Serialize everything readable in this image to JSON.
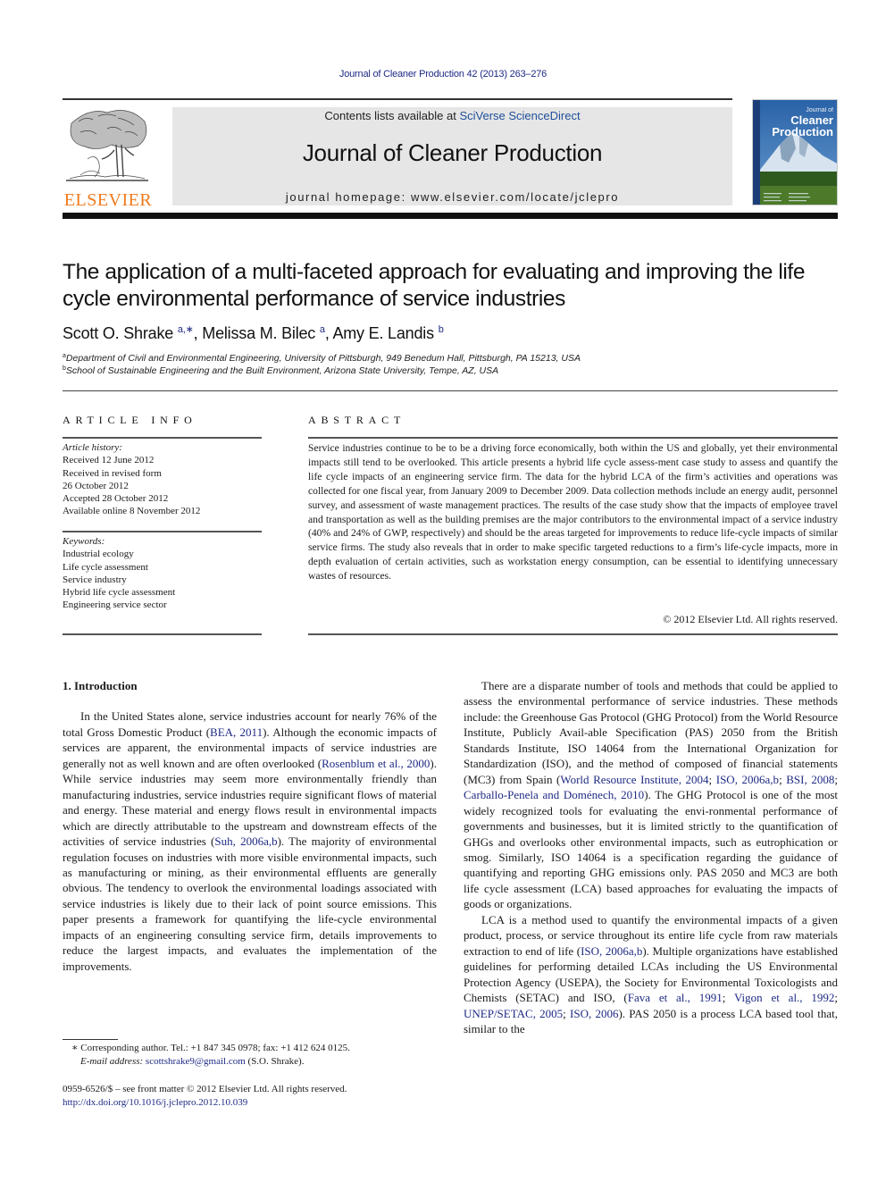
{
  "journal_reference": "Journal of Cleaner Production 42 (2013) 263–276",
  "publisher": {
    "logo_icon": "elsevier-tree-icon",
    "name": "ELSEVIER",
    "brand_color": "#f07a1c"
  },
  "masthead": {
    "contents_prefix": "Contents lists available at ",
    "contents_link": "SciVerse ScienceDirect",
    "journal_title": "Journal of Cleaner Production",
    "homepage": "journal homepage: www.elsevier.com/locate/jclepro"
  },
  "cover": {
    "icon": "journal-cover-mountain-image",
    "small_label": "Journal of",
    "title_line1": "Cleaner",
    "title_line2": "Production"
  },
  "article": {
    "title": "The application of a multi-faceted approach for evaluating and improving the life cycle environmental performance of service industries",
    "authors": [
      {
        "name": "Scott O. Shrake",
        "sup": "a,∗"
      },
      {
        "name": "Melissa M. Bilec",
        "sup": "a"
      },
      {
        "name": "Amy E. Landis",
        "sup": "b"
      }
    ],
    "affiliations": [
      {
        "sup": "a",
        "text": "Department of Civil and Environmental Engineering, University of Pittsburgh, 949 Benedum Hall, Pittsburgh, PA 15213, USA"
      },
      {
        "sup": "b",
        "text": "School of Sustainable Engineering and the Built Environment, Arizona State University, Tempe, AZ, USA"
      }
    ]
  },
  "article_info": {
    "heading": "ARTICLE INFO",
    "history_label": "Article history:",
    "history": [
      "Received 12 June 2012",
      "Received in revised form",
      "26 October 2012",
      "Accepted 28 October 2012",
      "Available online 8 November 2012"
    ],
    "keywords_label": "Keywords:",
    "keywords": [
      "Industrial ecology",
      "Life cycle assessment",
      "Service industry",
      "Hybrid life cycle assessment",
      "Engineering service sector"
    ]
  },
  "abstract": {
    "heading": "ABSTRACT",
    "text": "Service industries continue to be to be a driving force economically, both within the US and globally, yet their environmental impacts still tend to be overlooked. This article presents a hybrid life cycle assess-ment case study to assess and quantify the life cycle impacts of an engineering service firm. The data for the hybrid LCA of the firm’s activities and operations was collected for one fiscal year, from January 2009 to December 2009. Data collection methods include an energy audit, personnel survey, and assessment of waste management practices. The results of the case study show that the impacts of employee travel and transportation as well as the building premises are the major contributors to the environmental impact of a service industry (40% and 24% of GWP, respectively) and should be the areas targeted for improvements to reduce life-cycle impacts of similar service firms. The study also reveals that in order to make specific targeted reductions to a firm’s life-cycle impacts, more in depth evaluation of certain activities, such as workstation energy consumption, can be essential to identifying unnecessary wastes of resources.",
    "copyright": "© 2012 Elsevier Ltd. All rights reserved."
  },
  "body": {
    "section_heading": "1.  Introduction",
    "left_para": [
      {
        "t": "In the United States alone, service industries account for nearly 76% of the total Gross Domestic Product ("
      },
      {
        "l": "BEA, 2011"
      },
      {
        "t": "). Although the economic impacts of services are apparent, the environmental impacts of service industries are generally not as well known and are often overlooked ("
      },
      {
        "l": "Rosenblum et al., 2000"
      },
      {
        "t": "). While service industries may seem more environmentally friendly than manufacturing industries, service industries require significant flows of material and energy. These material and energy flows result in environmental impacts which are directly attributable to the upstream and downstream effects of the activities of service industries ("
      },
      {
        "l": "Suh, 2006a,b"
      },
      {
        "t": "). The majority of environmental regulation focuses on industries with more visible environmental impacts, such as manufacturing or mining, as their environmental effluents are generally obvious. The tendency to overlook the environmental loadings associated with service industries is likely due to their lack of point source emissions. This paper presents a framework for quantifying the life-cycle environmental impacts of an engineering consulting service firm, details improvements to reduce the largest impacts, and evaluates the implementation of the improvements."
      }
    ],
    "right_para_1": [
      {
        "t": "There are a disparate number of tools and methods that could be applied to assess the environmental performance of service industries. These methods include: the Greenhouse Gas Protocol (GHG Protocol) from the World Resource Institute, Publicly Avail-able Specification (PAS) 2050 from the British Standards Institute, ISO 14064 from the International Organization for Standardization (ISO), and the method of composed of financial statements (MC3) from Spain ("
      },
      {
        "l": "World Resource Institute, 2004"
      },
      {
        "t": "; "
      },
      {
        "l": "ISO, 2006a,b"
      },
      {
        "t": "; "
      },
      {
        "l": "BSI, 2008"
      },
      {
        "t": "; "
      },
      {
        "l": "Carballo-Penela and Doménech, 2010"
      },
      {
        "t": "). The GHG Protocol is one of the most widely recognized tools for evaluating the envi-ronmental performance of governments and businesses, but it is limited strictly to the quantification of GHGs and overlooks other environmental impacts, such as eutrophication or smog. Similarly, ISO 14064 is a specification regarding the guidance of quantifying and reporting GHG emissions only. PAS 2050 and MC3 are both life cycle assessment (LCA) based approaches for evaluating the impacts of goods or organizations."
      }
    ],
    "right_para_2": [
      {
        "t": "LCA is a method used to quantify the environmental impacts of a given product, process, or service throughout its entire life cycle from raw materials extraction to end of life ("
      },
      {
        "l": "ISO, 2006a,b"
      },
      {
        "t": "). Multiple organizations have established guidelines for performing detailed LCAs including the US Environmental Protection Agency (USEPA), the Society for Environmental Toxicologists and Chemists (SETAC) and ISO, ("
      },
      {
        "l": "Fava et al., 1991"
      },
      {
        "t": "; "
      },
      {
        "l": "Vigon et al., 1992"
      },
      {
        "t": "; "
      },
      {
        "l": "UNEP/SETAC, 2005"
      },
      {
        "t": "; "
      },
      {
        "l": "ISO, 2006"
      },
      {
        "t": "). PAS 2050 is a process LCA based tool that, similar to the"
      }
    ]
  },
  "footnotes": {
    "corresponding": "∗  Corresponding author. Tel.: +1 847 345 0978; fax: +1 412 624 0125.",
    "email_label": "E-mail address:",
    "email": "scottshrake9@gmail.com",
    "email_suffix": " (S.O. Shrake).",
    "front_matter": "0959-6526/$ – see front matter © 2012 Elsevier Ltd. All rights reserved.",
    "doi": "http://dx.doi.org/10.1016/j.jclepro.2012.10.039"
  },
  "colors": {
    "link": "#1f2a84",
    "masthead_bg": "#e6e6e6",
    "elsevier_orange": "#f07a1c"
  }
}
